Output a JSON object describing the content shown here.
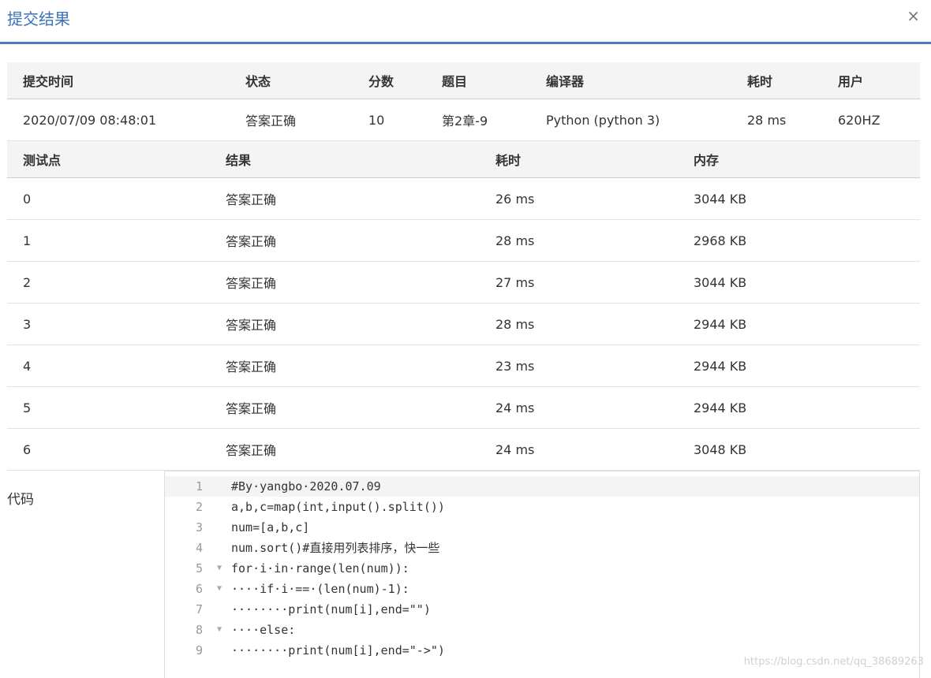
{
  "dialog": {
    "title": "提交结果",
    "close_glyph": "×"
  },
  "summary": {
    "headers": [
      "提交时间",
      "状态",
      "分数",
      "题目",
      "编译器",
      "耗时",
      "用户"
    ],
    "row": {
      "time": "2020/07/09 08:48:01",
      "status": "答案正确",
      "score": "10",
      "problem": "第2章-9",
      "compiler": "Python (python 3)",
      "elapsed": "28 ms",
      "user": "620HZ"
    }
  },
  "tests": {
    "headers": [
      "测试点",
      "结果",
      "耗时",
      "内存"
    ],
    "rows": [
      {
        "id": "0",
        "result": "答案正确",
        "time": "26 ms",
        "memory": "3044 KB"
      },
      {
        "id": "1",
        "result": "答案正确",
        "time": "28 ms",
        "memory": "2968 KB"
      },
      {
        "id": "2",
        "result": "答案正确",
        "time": "27 ms",
        "memory": "3044 KB"
      },
      {
        "id": "3",
        "result": "答案正确",
        "time": "28 ms",
        "memory": "2944 KB"
      },
      {
        "id": "4",
        "result": "答案正确",
        "time": "23 ms",
        "memory": "2944 KB"
      },
      {
        "id": "5",
        "result": "答案正确",
        "time": "24 ms",
        "memory": "2944 KB"
      },
      {
        "id": "6",
        "result": "答案正确",
        "time": "24 ms",
        "memory": "3048 KB"
      }
    ]
  },
  "code": {
    "label": "代码",
    "lines": [
      "#By·yangbo·2020.07.09",
      "a,b,c=map(int,input().split())",
      "num=[a,b,c]",
      "num.sort()#直接用列表排序，快一些",
      "for·i·in·range(len(num)):",
      "····if·i·==·(len(num)-1):",
      "········print(num[i],end=\"\")",
      "····else:",
      "········print(num[i],end=\"->\")"
    ]
  },
  "watermark": "https://blog.csdn.net/qq_38689263",
  "colors": {
    "accent": "#3b73b9",
    "correct": "#e0413a",
    "link": "#2b6cb0"
  }
}
